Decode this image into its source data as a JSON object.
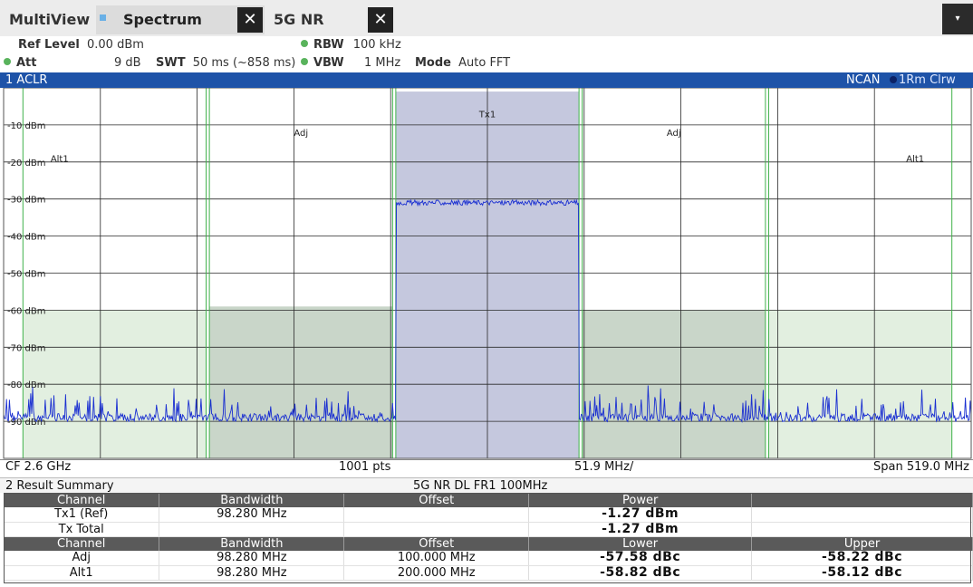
{
  "tabs": {
    "multiview": "MultiView",
    "spectrum": "Spectrum",
    "nr": "5G NR",
    "close_glyph": "✕",
    "menu_glyph": "▾"
  },
  "settings": {
    "ref_level_label": "Ref Level",
    "ref_level_value": "0.00 dBm",
    "att_label": "Att",
    "att_value": "9 dB",
    "swt_label": "SWT",
    "swt_value": "50 ms (~858 ms)",
    "rbw_label": "RBW",
    "rbw_value": "100 kHz",
    "vbw_label": "VBW",
    "vbw_value": "1 MHz",
    "mode_label": "Mode",
    "mode_value": "Auto FFT"
  },
  "diagram": {
    "title": "1 ACLR",
    "ncan": "NCAN",
    "trace": "1Rm Clrw",
    "accent": "#1e53a8"
  },
  "chart_data": {
    "type": "line",
    "y_unit": "dBm",
    "yticks": [
      "-10 dBm",
      "-20 dBm",
      "-30 dBm",
      "-40 dBm",
      "-50 dBm",
      "-60 dBm",
      "-70 dBm",
      "-80 dBm",
      "-90 dBm"
    ],
    "ylim": [
      -100,
      0
    ],
    "xlim": [
      2340.5,
      2859.5
    ],
    "x_unit": "MHz",
    "grid": true,
    "channels": [
      {
        "label": "Alt1",
        "start": 2350.86,
        "stop": 2449.14,
        "limit": -60,
        "color": "#e2efe0"
      },
      {
        "label": "Adj",
        "start": 2450.86,
        "stop": 2549.14,
        "limit": -59,
        "color": "#c9d6c9"
      },
      {
        "label": "Tx1",
        "start": 2550.86,
        "stop": 2649.14,
        "limit": -1,
        "color": "#c5c8de"
      },
      {
        "label": "Adj",
        "start": 2650.86,
        "stop": 2749.14,
        "limit": -60,
        "color": "#c9d6c9"
      },
      {
        "label": "Alt1",
        "start": 2750.86,
        "stop": 2849.14,
        "limit": -60,
        "color": "#e2efe0"
      }
    ],
    "series": [
      {
        "noise_floor": -89,
        "signal_level": -31,
        "signal_start": 2551,
        "signal_stop": 2649,
        "color": "#1a2fd1"
      }
    ]
  },
  "footer": {
    "cf": "CF 2.6 GHz",
    "pts": "1001 pts",
    "div": "51.9 MHz/",
    "span": "Span 519.0 MHz"
  },
  "result_summary": {
    "title": "2 Result Summary",
    "standard": "5G NR DL FR1 100MHz",
    "header1": [
      "Channel",
      "Bandwidth",
      "Offset",
      "Power",
      ""
    ],
    "rows1": [
      [
        "Tx1 (Ref)",
        "98.280 MHz",
        "",
        "-1.27 dBm",
        ""
      ],
      [
        "Tx Total",
        "",
        "",
        "-1.27 dBm",
        ""
      ]
    ],
    "header2": [
      "Channel",
      "Bandwidth",
      "Offset",
      "Lower",
      "Upper"
    ],
    "rows2": [
      [
        "Adj",
        "98.280 MHz",
        "100.000 MHz",
        "-57.58 dBc",
        "-58.22 dBc"
      ],
      [
        "Alt1",
        "98.280 MHz",
        "200.000 MHz",
        "-58.82 dBc",
        "-58.12 dBc"
      ]
    ]
  }
}
